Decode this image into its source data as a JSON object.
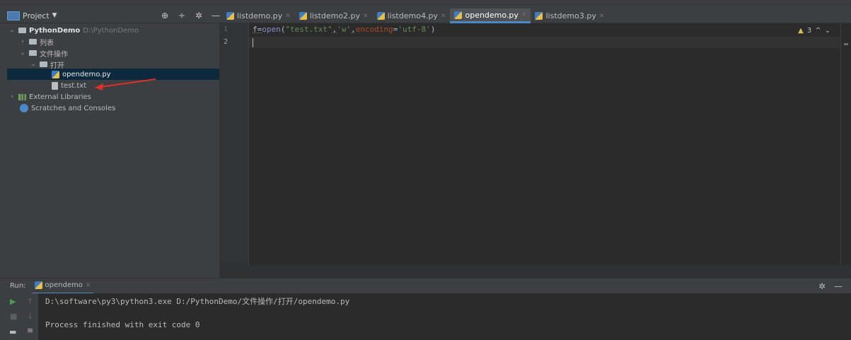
{
  "project_header": {
    "title": "Project"
  },
  "tree": {
    "root": {
      "label": "PythonDemo",
      "path": "D:\\PythonDemo"
    },
    "folder_list": "列表",
    "folder_file_ops": "文件操作",
    "folder_open": "打开",
    "file_opendemo": "opendemo.py",
    "file_test": "test.txt",
    "external_libs": "External Libraries",
    "scratches": "Scratches and Consoles"
  },
  "tabs": [
    {
      "label": "listdemo.py",
      "active": false
    },
    {
      "label": "listdemo2.py",
      "active": false
    },
    {
      "label": "listdemo4.py",
      "active": false
    },
    {
      "label": "opendemo.py",
      "active": true
    },
    {
      "label": "listdemo3.py",
      "active": false
    }
  ],
  "editor": {
    "line_numbers": [
      "1",
      "2"
    ],
    "code": {
      "ident": "f",
      "eq": "=",
      "builtin": "open",
      "p1": "(",
      "arg1": "\"test.txt\"",
      "comma1": ",",
      "arg2": "'w'",
      "comma2": ",",
      "kw": "encoding",
      "eq2": "=",
      "arg3": "'utf-8'",
      "p2": ")"
    },
    "warning_count": "3"
  },
  "run": {
    "label": "Run:",
    "tab": "opendemo",
    "console": [
      "D:\\software\\py3\\python3.exe D:/PythonDemo/文件操作/打开/opendemo.py",
      "",
      "Process finished with exit code 0"
    ]
  },
  "annotation": {
    "color": "#e0302a"
  }
}
